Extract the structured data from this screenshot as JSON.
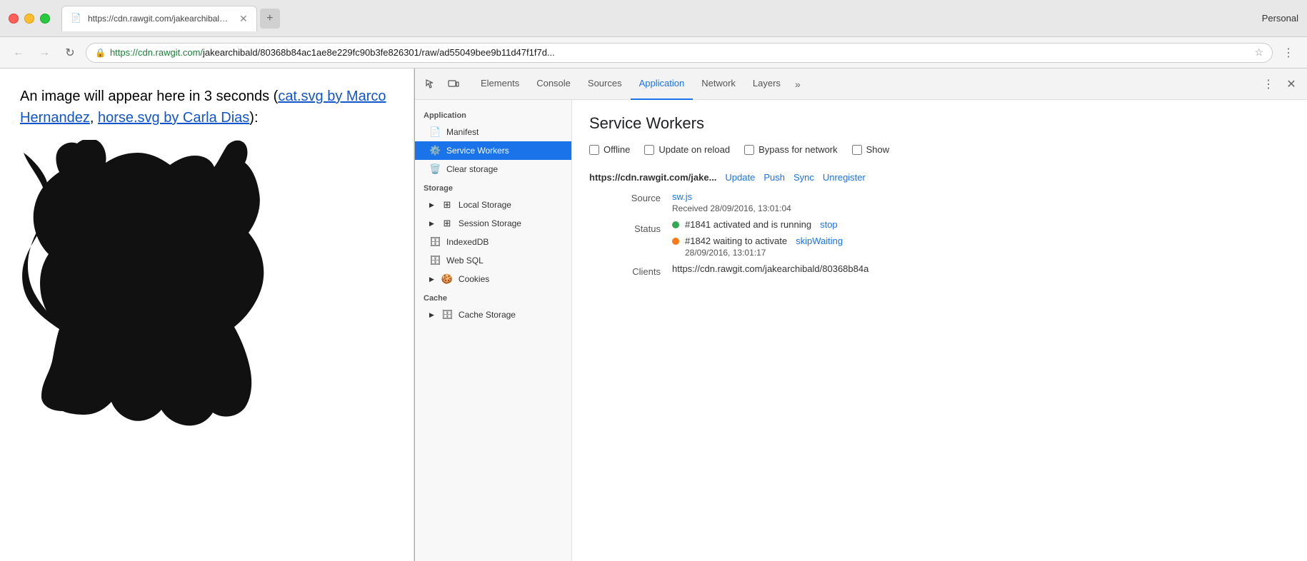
{
  "browser": {
    "profile": "Personal",
    "tab": {
      "url_display": "https://cdn.rawgit.com/jakearchibald/80368b84ac1ae8e229fc90b3fe826301/raw/ad55049bee9b11d47f1f7d...",
      "url_full": "https://cdn.rawgit.com/jakearchibald/80368b84ac1ae8e229fc90b3fe826301/raw/ad55049bee9b11d47f1f7d...",
      "url_base": "https://cdn.rawgit.com/",
      "url_rest": "jakearchibald/80368b84ac1ae8e229fc90b3fe826301/raw/ad55049bee9b11d47f1f7d...",
      "favicon": "📄"
    }
  },
  "page": {
    "text_before": "An image will appear here in 3 seconds (",
    "link1_text": "cat.svg by Marco Hernandez",
    "link1_href": "#",
    "link_separator": ", ",
    "link2_text": "horse.svg by Carla Dias",
    "link2_href": "#",
    "text_after": "):"
  },
  "devtools": {
    "tabs": [
      {
        "id": "elements",
        "label": "Elements",
        "active": false
      },
      {
        "id": "console",
        "label": "Console",
        "active": false
      },
      {
        "id": "sources",
        "label": "Sources",
        "active": false
      },
      {
        "id": "application",
        "label": "Application",
        "active": true
      },
      {
        "id": "network",
        "label": "Network",
        "active": false
      },
      {
        "id": "layers",
        "label": "Layers",
        "active": false
      }
    ],
    "sidebar": {
      "sections": [
        {
          "label": "Application",
          "items": [
            {
              "id": "manifest",
              "label": "Manifest",
              "icon": "📄",
              "active": false,
              "expandable": false
            },
            {
              "id": "service-workers",
              "label": "Service Workers",
              "icon": "⚙️",
              "active": true,
              "expandable": false
            },
            {
              "id": "clear-storage",
              "label": "Clear storage",
              "icon": "🗑️",
              "active": false,
              "expandable": false
            }
          ]
        },
        {
          "label": "Storage",
          "items": [
            {
              "id": "local-storage",
              "label": "Local Storage",
              "icon": "▦",
              "active": false,
              "expandable": true
            },
            {
              "id": "session-storage",
              "label": "Session Storage",
              "icon": "▦",
              "active": false,
              "expandable": true
            },
            {
              "id": "indexeddb",
              "label": "IndexedDB",
              "icon": "🗄️",
              "active": false,
              "expandable": false
            },
            {
              "id": "web-sql",
              "label": "Web SQL",
              "icon": "🗄️",
              "active": false,
              "expandable": false
            },
            {
              "id": "cookies",
              "label": "Cookies",
              "icon": "🍪",
              "active": false,
              "expandable": true
            }
          ]
        },
        {
          "label": "Cache",
          "items": [
            {
              "id": "cache-storage",
              "label": "Cache Storage",
              "icon": "🗄️",
              "active": false,
              "expandable": true
            }
          ]
        }
      ]
    },
    "main": {
      "title": "Service Workers",
      "checkboxes": [
        {
          "id": "offline",
          "label": "Offline",
          "checked": false
        },
        {
          "id": "update-on-reload",
          "label": "Update on reload",
          "checked": false
        },
        {
          "id": "bypass-for-network",
          "label": "Bypass for network",
          "checked": false
        },
        {
          "id": "show",
          "label": "Show",
          "checked": false
        }
      ],
      "worker": {
        "url": "https://cdn.rawgit.com/jake...",
        "actions": [
          "Update",
          "Push",
          "Sync",
          "Unregister"
        ],
        "source_label": "Source",
        "source_link": "sw.js",
        "received": "Received 28/09/2016, 13:01:04",
        "status_label": "Status",
        "statuses": [
          {
            "dot": "green",
            "text": "#1841 activated and is running",
            "action": "stop",
            "sub": null
          },
          {
            "dot": "orange",
            "text": "#1842 waiting to activate",
            "action": "skipWaiting",
            "sub": "28/09/2016, 13:01:17"
          }
        ],
        "clients_label": "Clients",
        "clients_value": "https://cdn.rawgit.com/jakearchibald/80368b84a"
      }
    }
  }
}
